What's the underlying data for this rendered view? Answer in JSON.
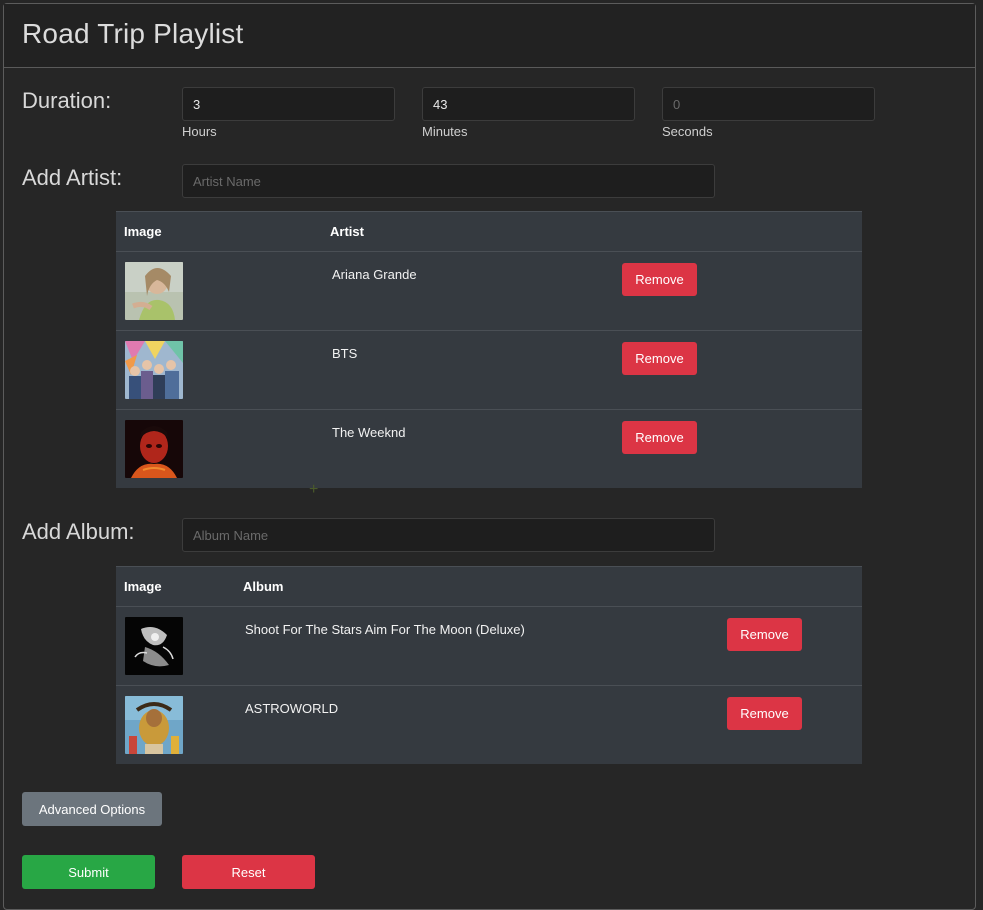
{
  "header": {
    "title": "Road Trip Playlist"
  },
  "duration": {
    "label": "Duration:",
    "hours": {
      "value": "3",
      "label": "Hours"
    },
    "minutes": {
      "value": "43",
      "label": "Minutes"
    },
    "seconds": {
      "placeholder": "0",
      "label": "Seconds"
    }
  },
  "artist": {
    "label": "Add Artist:",
    "placeholder": "Artist Name",
    "table": {
      "headers": [
        "Image",
        "Artist"
      ],
      "rows": [
        {
          "name": "Ariana Grande",
          "image": "ariana-grande-photo",
          "action": "Remove"
        },
        {
          "name": "BTS",
          "image": "bts-photo",
          "action": "Remove"
        },
        {
          "name": "The Weeknd",
          "image": "the-weeknd-photo",
          "action": "Remove"
        }
      ]
    }
  },
  "album": {
    "label": "Add Album:",
    "placeholder": "Album Name",
    "table": {
      "headers": [
        "Image",
        "Album"
      ],
      "rows": [
        {
          "name": "Shoot For The Stars Aim For The Moon (Deluxe)",
          "image": "album-cover-dark",
          "action": "Remove"
        },
        {
          "name": "ASTROWORLD",
          "image": "album-cover-astroworld",
          "action": "Remove"
        }
      ]
    }
  },
  "actions": {
    "advanced": "Advanced Options",
    "submit": "Submit",
    "reset": "Reset"
  },
  "colors": {
    "danger": "#dc3545",
    "success": "#28a745",
    "secondary": "#6c757d",
    "background": "#262626",
    "table": "#353a40"
  }
}
